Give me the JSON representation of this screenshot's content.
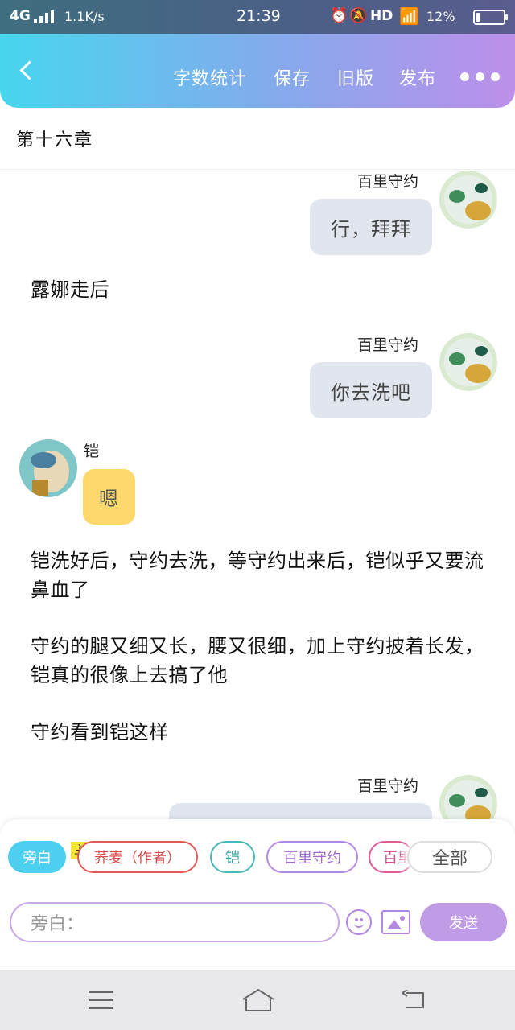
{
  "status_bar": {
    "network": "4G",
    "speed": "1.1K/s",
    "time": "21:39",
    "hd": "HD",
    "battery": "12%",
    "battery_level": 0.12
  },
  "header": {
    "back_icon": "chevron-left-icon",
    "buttons": [
      "字数统计",
      "保存",
      "旧版",
      "发布"
    ],
    "more_icon": "more-dots-icon"
  },
  "chapter_title": "第十六章",
  "messages": [
    {
      "type": "right",
      "name": "百里守约",
      "text": "行，拜拜"
    },
    {
      "type": "narration",
      "text": "露娜走后"
    },
    {
      "type": "right",
      "name": "百里守约",
      "text": "你去洗吧"
    },
    {
      "type": "left",
      "name": "铠",
      "text": "嗯"
    },
    {
      "type": "narration",
      "text": "铠洗好后，守约去洗，等守约出来后，铠似乎又要流鼻血了"
    },
    {
      "type": "narration",
      "text": "守约的腿又细又长，腰又很细，加上守约披着长发，铠真的很像上去搞了他"
    },
    {
      "type": "narration",
      "text": "守约看到铠这样"
    },
    {
      "type": "right",
      "name": "百里守约",
      "text": ""
    }
  ],
  "role_bar": {
    "active": "旁白",
    "author_badge": "主",
    "chips": [
      "旁白",
      "荞麦（作者）",
      "铠",
      "百里守约",
      "百里"
    ],
    "all_button": "全部"
  },
  "input": {
    "placeholder": "旁白：",
    "send_label": "发送"
  },
  "colors": {
    "header_start": "#47d6ee",
    "header_end": "#bd8fe9",
    "active_chip": "#4dd0f0",
    "bubble_grey": "#e1e6ee",
    "bubble_yellow": "#fcd96a",
    "send_button": "#c09be6"
  }
}
